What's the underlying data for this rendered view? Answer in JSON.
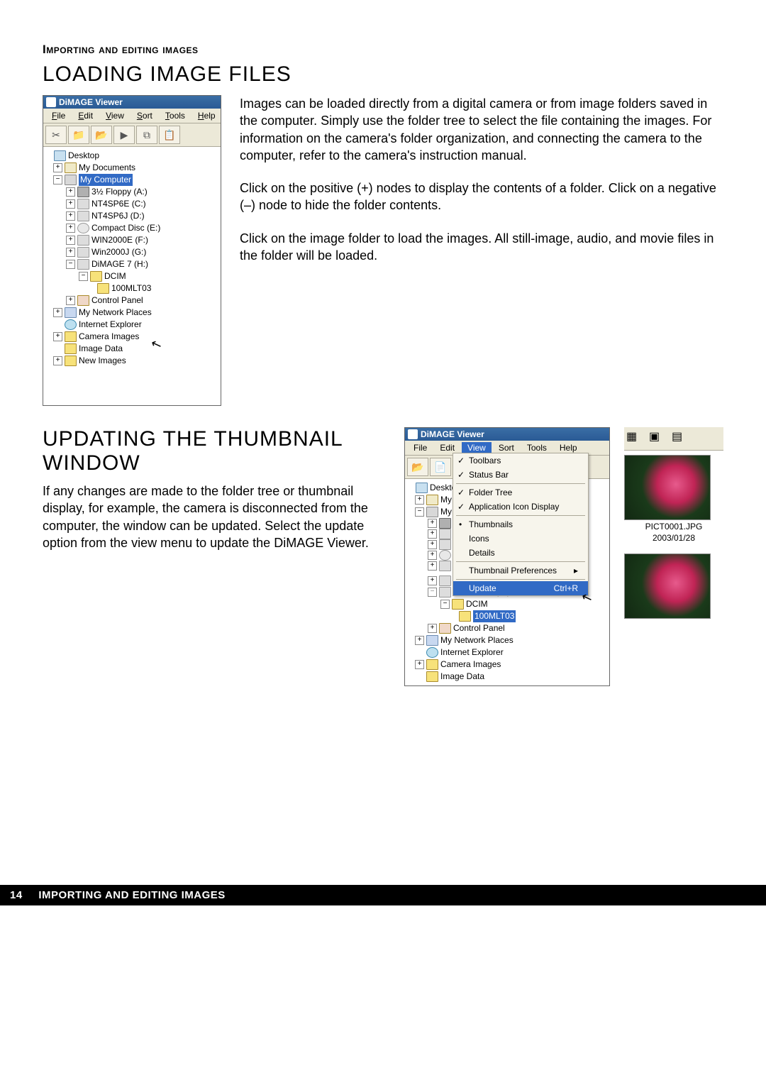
{
  "section_header": "Importing and editing images",
  "h1_loading": "LOADING IMAGE FILES",
  "para1": "Images can be loaded directly from a digital camera or from image folders saved in the computer. Simply use the folder tree to select the file containing the images. For information on the camera's folder organization, and connecting the camera to the computer, refer to the camera's instruction manual.",
  "para2": "Click on the positive (+) nodes to display the contents of a folder. Click on a negative (–) node to hide the folder contents.",
  "para3": "Click on the image folder to load the images. All still-image, audio, and movie files in the folder will be loaded.",
  "app_title": "DiMAGE Viewer",
  "menu": {
    "file": "File",
    "edit": "Edit",
    "view": "View",
    "sort": "Sort",
    "tools": "Tools",
    "help": "Help"
  },
  "tree1": {
    "desktop": "Desktop",
    "mydocs": "My Documents",
    "mycomputer": "My Computer",
    "floppy": "3½ Floppy (A:)",
    "c": "NT4SP6E (C:)",
    "d": "NT4SP6J (D:)",
    "e": "Compact Disc (E:)",
    "f": "WIN2000E (F:)",
    "g": "Win2000J (G:)",
    "h": "DiMAGE 7 (H:)",
    "dcim": "DCIM",
    "leaf": "100MLT03",
    "cp": "Control Panel",
    "net": "My Network Places",
    "ie": "Internet Explorer",
    "cam": "Camera Images",
    "imgdata": "Image Data",
    "newimg": "New Images"
  },
  "h1_update": "UPDATING THE THUMBNAIL WINDOW",
  "para_update": "If any changes are made to the folder tree or thumbnail display, for example, the camera is disconnected from the computer, the window can be updated. Select the update option from the view menu to update the DiMAGE Viewer.",
  "viewmenu": {
    "toolbars": "Toolbars",
    "statusbar": "Status Bar",
    "foldertree": "Folder Tree",
    "appicon": "Application Icon Display",
    "thumbs": "Thumbnails",
    "icons": "Icons",
    "details": "Details",
    "thumbprefs": "Thumbnail Preferences",
    "update": "Update",
    "shortcut": "Ctrl+R"
  },
  "thumb": {
    "file": "PICT0001.JPG",
    "date": "2003/01/28"
  },
  "footer": {
    "page": "14",
    "text": "IMPORTING AND EDITING IMAGES"
  }
}
